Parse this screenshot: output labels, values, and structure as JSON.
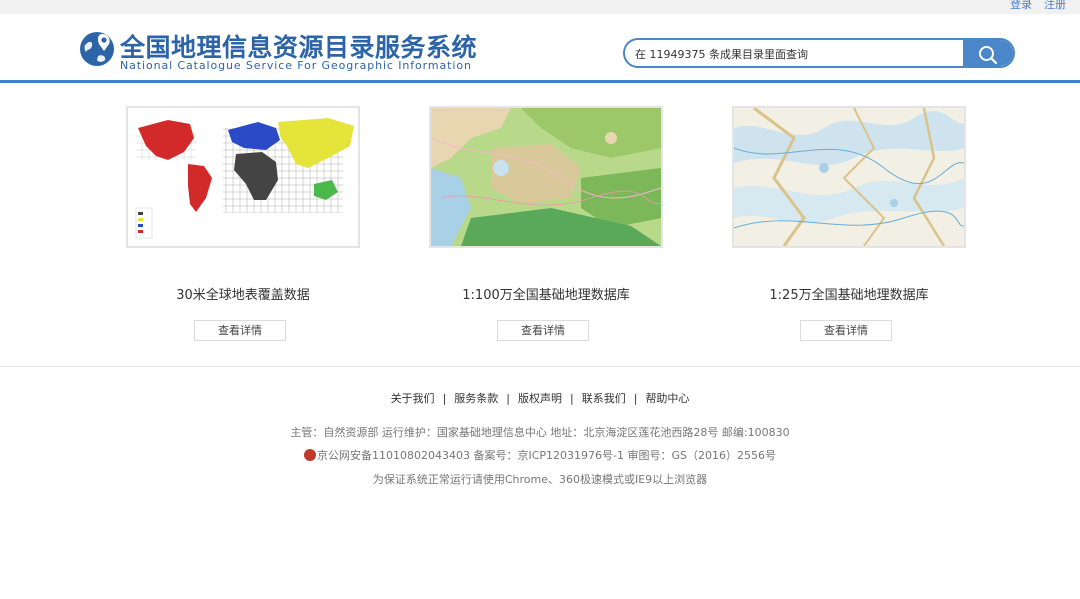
{
  "top_links": {
    "login": "登录",
    "register": "注册"
  },
  "header": {
    "title_cn": "全国地理信息资源目录服务系统",
    "title_en": "National Catalogue Service For Geographic Information",
    "search_placeholder": "在 11949375 条成果目录里面查询"
  },
  "cards": [
    {
      "title": "30米全球地表覆盖数据",
      "button": "查看详情"
    },
    {
      "title": "1:100万全国基础地理数据库",
      "button": "查看详情"
    },
    {
      "title": "1:25万全国基础地理数据库",
      "button": "查看详情"
    }
  ],
  "footer": {
    "links": [
      "关于我们",
      "服务条款",
      "版权声明",
      "联系我们",
      "帮助中心"
    ],
    "separator": "|",
    "line1": "主管：自然资源部 运行维护：国家基础地理信息中心 地址：北京海淀区莲花池西路28号 邮编:100830",
    "line2": "京公网安备11010802043403 备案号：京ICP12031976号-1 审图号：GS（2016）2556号",
    "line3": "为保证系统正常运行请使用Chrome、360极速模式或IE9以上浏览器"
  },
  "colors": {
    "brand": "#2d64a8",
    "accent": "#4a86c8",
    "link": "#4a7fc6"
  }
}
